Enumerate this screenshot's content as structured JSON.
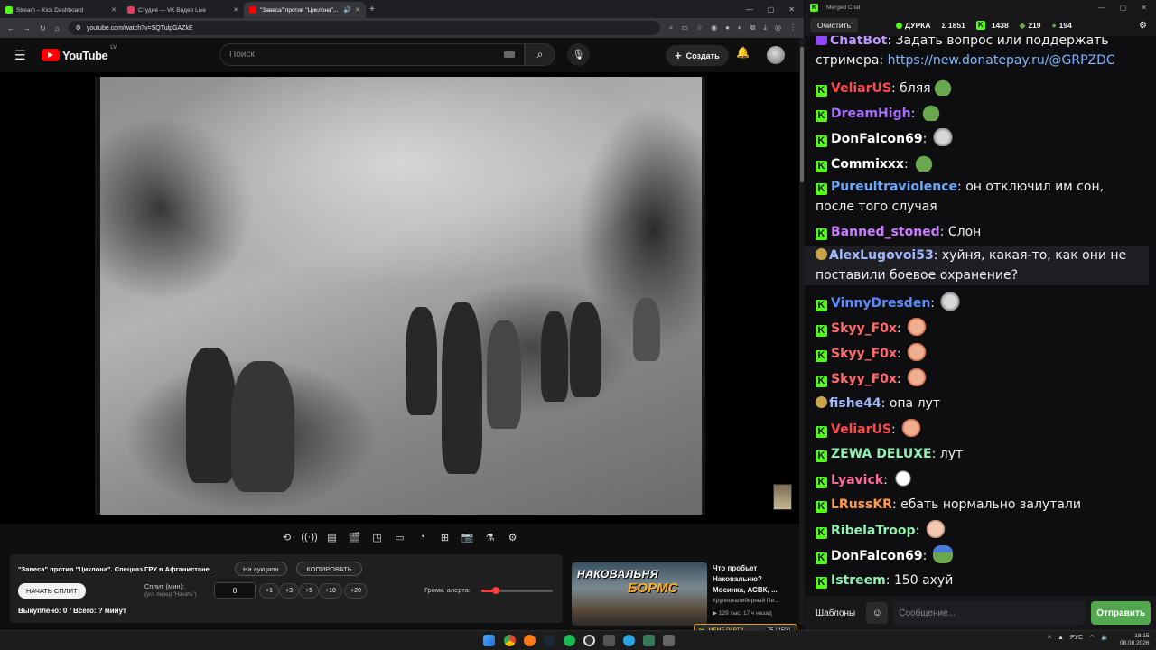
{
  "browser": {
    "tabs": [
      {
        "title": "Stream – Kick Dashboard",
        "color": "#53fc18"
      },
      {
        "title": "Студия — VK Видео Live",
        "color": "#e04060"
      },
      {
        "title": "\"Завеса\" против \"Циклона\"...",
        "color": "#ff0000"
      }
    ],
    "url": "youtube.com/watch?v=SQTulpGAZkE"
  },
  "youtube": {
    "logo_text": "YouTube",
    "logo_region": "LV",
    "search_placeholder": "Поиск",
    "create_label": "Создать"
  },
  "panel": {
    "video_title": "\"Завеса\" против \"Циклона\". Спецназ ГРУ в Афганистане.",
    "auction_label": "На аукцион",
    "copy_label": "КОПИРОВАТЬ",
    "start_split_label": "НАЧАТЬ СПЛИТ",
    "split_label": "Сплит (мин):",
    "split_hint": "(уст. перед \"Начать\")",
    "split_value": "0",
    "steps": [
      "+1",
      "+3",
      "+5",
      "+10",
      "+20"
    ],
    "alert_volume_label": "Громк. алерта:",
    "alert_volume_level": 0.2,
    "bought_text": "Выкуплено: 0 / Всего: ? минут"
  },
  "recommendation": {
    "thumb_text_1": "НАКОВАЛЬНЯ",
    "thumb_text_2": "БОРМС",
    "title": "Что пробьет Наковальню? Мосинка, АСВК, ...",
    "channel": "Крупнокалиберный Пе...",
    "meta": "129 тыс.  17 ч назад"
  },
  "memeparty": {
    "label": "MEME PARTY",
    "count": "75 / 1500"
  },
  "chat": {
    "window_title": "Merged Chat",
    "clear_label": "Очистить",
    "channel": "ДУРКА",
    "total": "Σ 1851",
    "kick_count": "1438",
    "other_count": "219",
    "third_count": "194",
    "messages": [
      {
        "user": "ChatBot",
        "color": "#bf94ff",
        "text": "Задать вопрос или поддержать стримера: ",
        "link": "https://new.donatepay.ru/@GRPZDC",
        "badge": "bot"
      },
      {
        "user": "VeliarUS",
        "color": "#ff4a4a",
        "text": "бляя",
        "emote": "frog",
        "badge": "kick"
      },
      {
        "user": "DreamHigh",
        "color": "#a970ff",
        "text": "",
        "emote": "frog",
        "badge": "kick"
      },
      {
        "user": "DonFalcon69",
        "color": "#ffffff",
        "text": "",
        "emote": "cat",
        "badge": "kick"
      },
      {
        "user": "Commixxx",
        "color": "#ffffff",
        "text": "",
        "emote": "frog",
        "badge": "kick"
      },
      {
        "user": "Pureultraviolence",
        "color": "#6aa8ff",
        "text": "он отключил им сон, после того случая",
        "badge": "kick"
      },
      {
        "user": "Banned_stoned",
        "color": "#c97cff",
        "text": "Слон",
        "badge": "kick"
      },
      {
        "user": "AlexLugovoi53",
        "color": "#9fb8ff",
        "text": "хуйня, какая-то, как они не поставили боевое охранение?",
        "badge": "other"
      },
      {
        "user": "VinnyDresden",
        "color": "#5a8cff",
        "text": "",
        "emote": "cat",
        "badge": "kick"
      },
      {
        "user": "Skyy_F0x",
        "color": "#ff6b6b",
        "text": "",
        "emote": "face",
        "badge": "kick"
      },
      {
        "user": "Skyy_F0x",
        "color": "#ff6b6b",
        "text": "",
        "emote": "face",
        "badge": "kick"
      },
      {
        "user": "Skyy_F0x",
        "color": "#ff6b6b",
        "text": "",
        "emote": "face",
        "badge": "kick"
      },
      {
        "user": "fishe44",
        "color": "#9fb8ff",
        "text": "опа лут",
        "badge": "other"
      },
      {
        "user": "VeliarUS",
        "color": "#ff4a4a",
        "text": "",
        "emote": "face",
        "badge": "kick"
      },
      {
        "user": "ZEWA DELUXE",
        "color": "#8ff0b0",
        "text": "лут",
        "badge": "kick"
      },
      {
        "user": "Lyavick",
        "color": "#ff6b9a",
        "text": "",
        "emote": "ghost",
        "badge": "kick"
      },
      {
        "user": "LRussKR",
        "color": "#ff9a4a",
        "text": "ебать нормально залутали",
        "badge": "kick"
      },
      {
        "user": "RibelaTroop",
        "color": "#8ff0b0",
        "text": "",
        "emote": "baby",
        "badge": "kick"
      },
      {
        "user": "DonFalcon69",
        "color": "#ffffff",
        "text": "",
        "emote": "frog2",
        "badge": "kick"
      },
      {
        "user": "Istreem",
        "color": "#8ff0b0",
        "text": "150 ахуй",
        "badge": "kick"
      }
    ],
    "templates_label": "Шаблоны",
    "input_placeholder": "Сообщение...",
    "send_label": "Отправить"
  },
  "taskbar": {
    "lang": "РУС",
    "time": "18:15",
    "date": "08.08.2026"
  }
}
